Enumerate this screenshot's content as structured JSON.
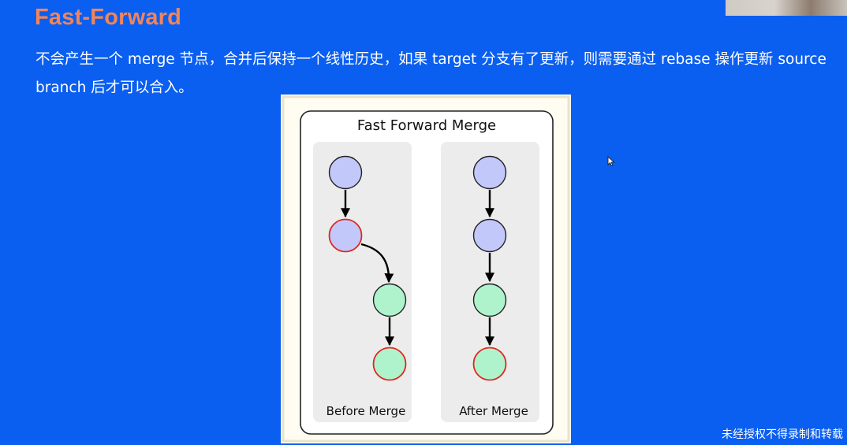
{
  "header": {
    "title": "Fast-Forward"
  },
  "description": "不会产生一个 merge 节点，合并后保持一个线性历史，如果 target 分支有了更新，则需要通过 rebase 操作更新 source branch 后才可以合入。",
  "diagram": {
    "title": "Fast Forward Merge",
    "before_label": "Before Merge",
    "after_label": "After Merge",
    "colors": {
      "blue_node": "#c3c8fb",
      "green_node": "#aff3cd",
      "head_stroke": "#e0261e",
      "panel": "#ececec"
    }
  },
  "watermark": "未经授权不得录制和转载",
  "icons": {
    "cursor": "mouse-pointer-icon"
  }
}
